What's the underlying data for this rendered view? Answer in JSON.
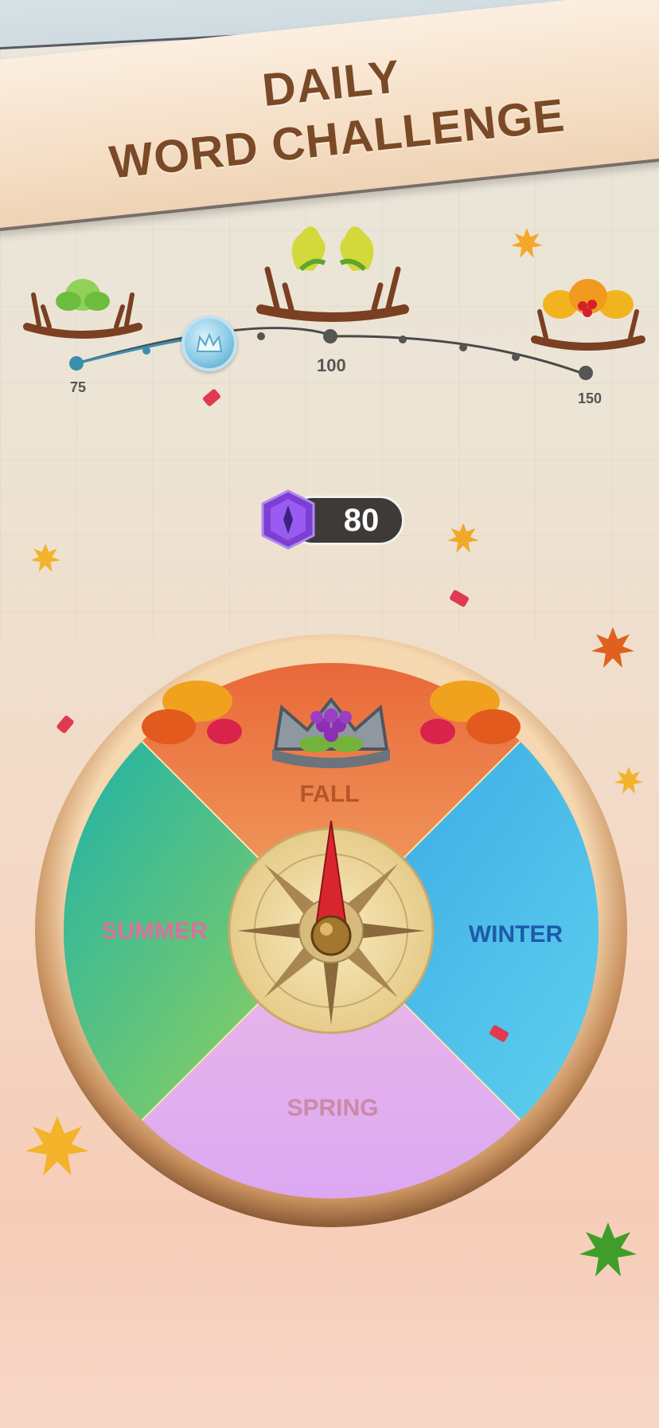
{
  "title": {
    "line1": "DAILY",
    "line2": "WORD CHALLENGE"
  },
  "progress": {
    "milestones": [
      {
        "label": "75"
      },
      {
        "label": "100"
      },
      {
        "label": "150"
      }
    ],
    "current_icon": "crown-icon"
  },
  "gems": {
    "count": "80",
    "icon": "purple-gem-icon"
  },
  "wheel": {
    "segments": [
      {
        "label": "FALL",
        "color": "#e8884a",
        "text_color": "#b5552a"
      },
      {
        "label": "WINTER",
        "color": "#3fb4e6",
        "text_color": "#1e5aa8"
      },
      {
        "label": "SPRING",
        "color": "#e3aeee",
        "text_color": "#c98aa8"
      },
      {
        "label": "SUMMER",
        "color": "#3cc3a8",
        "text_color": "#d6739a"
      }
    ],
    "center_icon": "compass-icon",
    "top_icon": "grape-crown-icon"
  },
  "colors": {
    "title": "#7a4a26",
    "banner": "#f5dfc6",
    "rim": "#c8905e"
  }
}
